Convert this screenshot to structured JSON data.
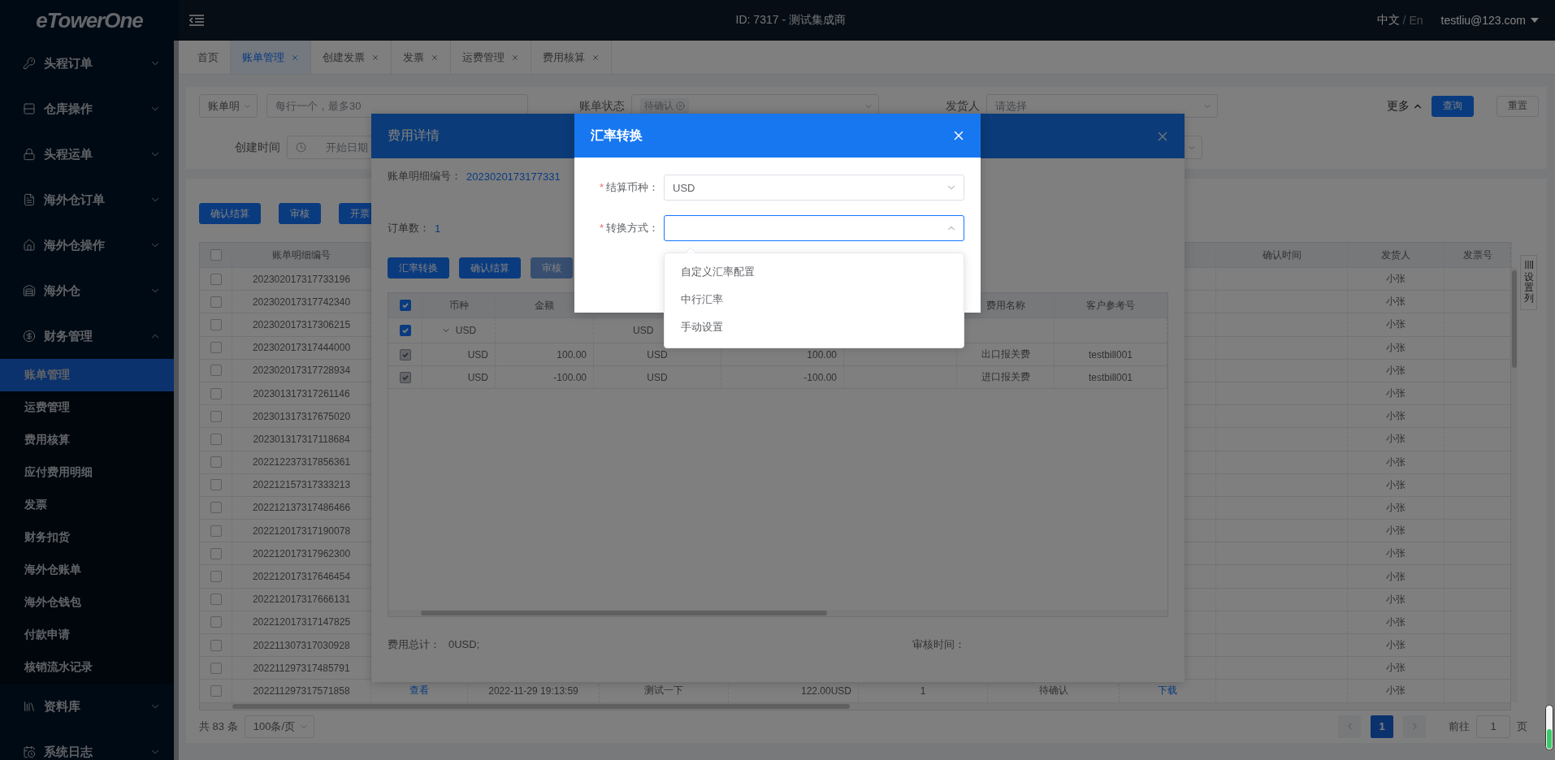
{
  "sidebar": {
    "logo": "eTowerOne",
    "items": [
      {
        "label": "头程订单",
        "expanded": false
      },
      {
        "label": "仓库操作",
        "expanded": false
      },
      {
        "label": "头程运单",
        "expanded": false
      },
      {
        "label": "海外仓订单",
        "expanded": false
      },
      {
        "label": "海外仓操作",
        "expanded": false
      },
      {
        "label": "海外仓",
        "expanded": false
      },
      {
        "label": "财务管理",
        "expanded": true,
        "children": [
          {
            "label": "账单管理",
            "selected": true
          },
          {
            "label": "运费管理",
            "selected": false
          },
          {
            "label": "费用核算",
            "selected": false
          },
          {
            "label": "应付费用明细",
            "selected": false
          },
          {
            "label": "发票",
            "selected": false
          },
          {
            "label": "财务扣货",
            "selected": false
          },
          {
            "label": "海外仓账单",
            "selected": false
          },
          {
            "label": "海外仓钱包",
            "selected": false
          },
          {
            "label": "付款申请",
            "selected": false
          },
          {
            "label": "核销流水记录",
            "selected": false
          }
        ]
      },
      {
        "label": "资料库",
        "expanded": false
      },
      {
        "label": "系统日志",
        "expanded": false
      }
    ]
  },
  "topbar": {
    "title": "ID: 7317 - 测试集成商",
    "languages": [
      {
        "label": "中文",
        "selected": true
      },
      {
        "label": "En",
        "selected": false
      }
    ],
    "separator": "/",
    "user": "testliu@123.com"
  },
  "tabs": [
    {
      "label": "首页",
      "closable": false,
      "selected": false
    },
    {
      "label": "账单管理",
      "closable": true,
      "selected": true
    },
    {
      "label": "创建发票",
      "closable": true,
      "selected": false
    },
    {
      "label": "发票",
      "closable": true,
      "selected": false
    },
    {
      "label": "运费管理",
      "closable": true,
      "selected": false
    },
    {
      "label": "费用核算",
      "closable": true,
      "selected": false
    }
  ],
  "filters": {
    "search_type": "账单明",
    "search_placeholder": "每行一个，最多30",
    "status_label": "账单状态",
    "status_tag": "待确认",
    "shipper_label": "发货人",
    "shipper_placeholder": "请选择",
    "created_label": "创建时间",
    "date_start_placeholder": "开始日期",
    "more": "更多",
    "query": "查询",
    "reset": "重置"
  },
  "toolbar_buttons": [
    "确认结算",
    "审核",
    "开票"
  ],
  "table": {
    "header_checked": false,
    "columns": [
      "账单明细编号",
      null,
      null,
      null,
      null,
      null,
      null,
      null,
      "确认时间",
      "发货人",
      "发票号"
    ],
    "side_tab": "设置列",
    "rows": [
      {
        "checked": false,
        "cells": [
          "202302017317733196",
          null,
          null,
          null,
          null,
          null,
          null,
          null,
          null,
          "小张",
          null
        ]
      },
      {
        "checked": false,
        "cells": [
          "202302017317742340",
          null,
          null,
          null,
          null,
          null,
          null,
          null,
          null,
          "小张",
          null
        ]
      },
      {
        "checked": false,
        "cells": [
          "202302017317306215",
          null,
          null,
          null,
          null,
          null,
          null,
          null,
          null,
          "小张",
          null
        ]
      },
      {
        "checked": false,
        "cells": [
          "202302017317444000",
          null,
          null,
          null,
          null,
          null,
          null,
          null,
          null,
          "小张",
          null
        ]
      },
      {
        "checked": false,
        "cells": [
          "202302017317728934",
          null,
          null,
          null,
          null,
          null,
          null,
          null,
          null,
          "小张",
          null
        ]
      },
      {
        "checked": false,
        "cells": [
          "202301317317261146",
          null,
          null,
          null,
          null,
          null,
          null,
          null,
          null,
          "小张",
          null
        ]
      },
      {
        "checked": false,
        "cells": [
          "202301317317675020",
          null,
          null,
          null,
          null,
          null,
          null,
          null,
          null,
          "小张",
          null
        ]
      },
      {
        "checked": false,
        "cells": [
          "202301317317118684",
          null,
          null,
          null,
          null,
          null,
          null,
          null,
          null,
          "小张",
          null
        ]
      },
      {
        "checked": false,
        "cells": [
          "202212237317856361",
          null,
          null,
          null,
          null,
          null,
          null,
          null,
          null,
          "小张",
          null
        ]
      },
      {
        "checked": false,
        "cells": [
          "202212157317333213",
          null,
          null,
          null,
          null,
          null,
          null,
          null,
          null,
          "小张",
          null
        ]
      },
      {
        "checked": false,
        "cells": [
          "202212137317486466",
          null,
          null,
          null,
          null,
          null,
          null,
          null,
          null,
          "小张",
          null
        ]
      },
      {
        "checked": false,
        "cells": [
          "202212017317190078",
          null,
          null,
          null,
          null,
          null,
          null,
          null,
          null,
          "小张",
          null
        ]
      },
      {
        "checked": false,
        "cells": [
          "202212017317962300",
          null,
          null,
          null,
          null,
          null,
          null,
          null,
          null,
          "小张",
          null
        ]
      },
      {
        "checked": false,
        "cells": [
          "202212017317646454",
          null,
          null,
          null,
          null,
          null,
          null,
          null,
          null,
          "小张",
          null
        ]
      },
      {
        "checked": false,
        "cells": [
          "202212017317666131",
          null,
          null,
          null,
          null,
          null,
          null,
          null,
          null,
          "小张",
          null
        ]
      },
      {
        "checked": false,
        "cells": [
          "202212017317147825",
          null,
          null,
          null,
          null,
          null,
          null,
          null,
          null,
          "小张",
          null
        ]
      },
      {
        "checked": false,
        "cells": [
          "202211307317030928",
          null,
          null,
          null,
          null,
          null,
          null,
          null,
          null,
          "小张",
          null
        ]
      },
      {
        "checked": false,
        "cells": [
          "202211297317485791",
          null,
          null,
          null,
          null,
          null,
          null,
          null,
          null,
          "小张",
          null
        ]
      },
      {
        "checked": false,
        "cells": [
          "202211297317571858",
          "查看",
          "2022-11-29 19:13:59",
          "测试一下",
          "122.00USD",
          "1",
          "待确认",
          "下载",
          null,
          "小张",
          null
        ]
      }
    ]
  },
  "pagination": {
    "total": "共 83 条",
    "page_size": "100条/页",
    "pages": [
      {
        "label": "1",
        "selected": true
      }
    ],
    "goto_label": "前往",
    "goto_value": "1",
    "goto_suffix": "页"
  },
  "detail_dialog": {
    "title": "费用详情",
    "number_label": "账单明细编号：",
    "number": "2023020173177331",
    "orders_label": "订单数：",
    "orders": "1",
    "buttons": [
      {
        "label": "汇率转换",
        "disabled": false
      },
      {
        "label": "确认结算",
        "disabled": false
      },
      {
        "label": "审核",
        "disabled": true
      }
    ],
    "table": {
      "header_checked": true,
      "columns": [
        "币种",
        "金额",
        null,
        null,
        null,
        "费用名称",
        "客户参考号"
      ],
      "rows": [
        {
          "kind": "group",
          "checked": true,
          "disabled": false,
          "expanded": true,
          "cells": [
            "USD",
            null,
            "USD",
            null,
            null,
            null,
            null
          ]
        },
        {
          "kind": "item",
          "checked": true,
          "disabled": true,
          "cells": [
            "USD",
            "100.00",
            "USD",
            "100.00",
            null,
            "出口报关费",
            "testbill001"
          ]
        },
        {
          "kind": "item",
          "checked": true,
          "disabled": true,
          "cells": [
            "USD",
            "-100.00",
            "USD",
            "-100.00",
            null,
            "进口报关费",
            "testbill001"
          ]
        }
      ]
    },
    "total_label": "费用总计：",
    "total": "0USD;",
    "review_label": "审核时间："
  },
  "exchange_dialog": {
    "title": "汇率转换",
    "fields": [
      {
        "label": "结算币种：",
        "mark": "*",
        "value": "USD",
        "focused": false
      },
      {
        "label": "转换方式：",
        "mark": "*",
        "focused": true
      }
    ],
    "options": [
      "自定义汇率配置",
      "中行汇率",
      "手动设置"
    ]
  }
}
